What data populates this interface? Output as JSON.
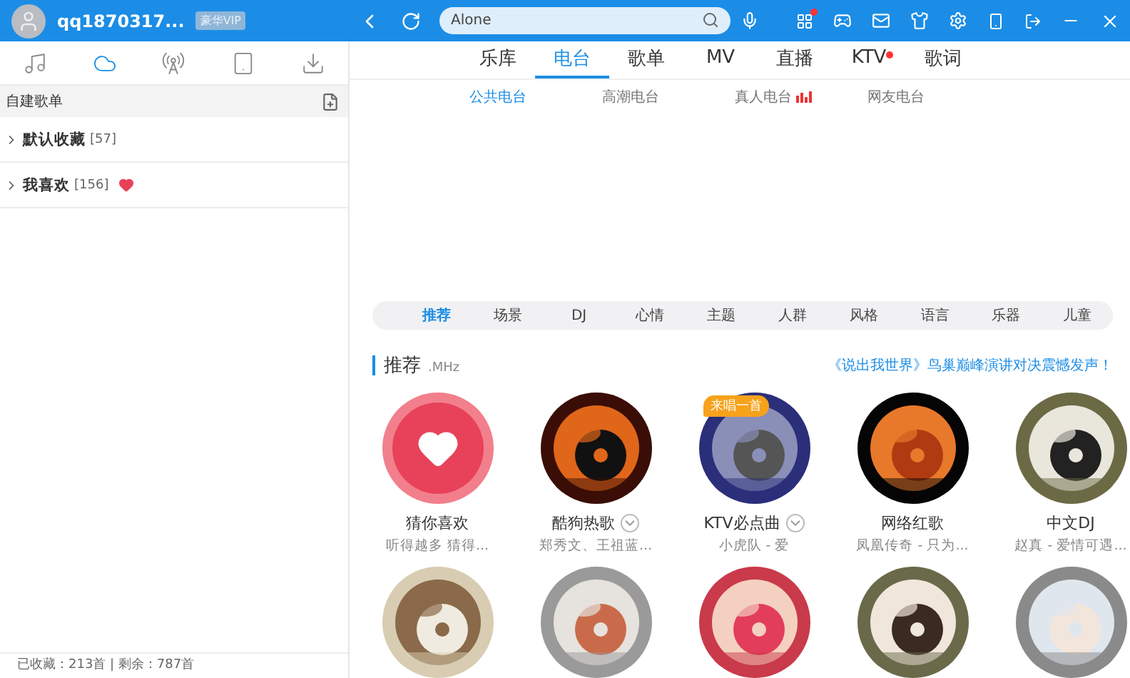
{
  "header": {
    "username": "qq1870317...",
    "vip_badge": "豪华VIP",
    "search": {
      "value": "Alone"
    },
    "apps_dot": true
  },
  "left_tabs": [
    {
      "kind": "music",
      "selected": false
    },
    {
      "kind": "cloud",
      "selected": true
    },
    {
      "kind": "radio",
      "selected": false
    },
    {
      "kind": "device",
      "selected": false
    },
    {
      "kind": "download",
      "selected": false
    }
  ],
  "playlist_section": {
    "title": "自建歌单"
  },
  "playlists": [
    {
      "name": "默认收藏",
      "count": "[57]",
      "liked": false
    },
    {
      "name": "我喜欢",
      "count": "[156]",
      "liked": true
    }
  ],
  "status_bar": "已收藏：213首 | 剩余：787首",
  "nav_tabs": [
    {
      "label": "乐库",
      "selected": false,
      "dot": false
    },
    {
      "label": "电台",
      "selected": true,
      "dot": false
    },
    {
      "label": "歌单",
      "selected": false,
      "dot": false
    },
    {
      "label": "MV",
      "selected": false,
      "dot": false
    },
    {
      "label": "直播",
      "selected": false,
      "dot": false
    },
    {
      "label": "KTV",
      "selected": false,
      "dot": true
    },
    {
      "label": "歌词",
      "selected": false,
      "dot": false
    }
  ],
  "sub_tabs": [
    {
      "label": "公共电台",
      "selected": true,
      "live": false
    },
    {
      "label": "高潮电台",
      "selected": false,
      "live": false
    },
    {
      "label": "真人电台",
      "selected": false,
      "live": true
    },
    {
      "label": "网友电台",
      "selected": false,
      "live": false
    }
  ],
  "categories": [
    {
      "label": "推荐",
      "selected": true
    },
    {
      "label": "场景",
      "selected": false
    },
    {
      "label": "DJ",
      "selected": false
    },
    {
      "label": "心情",
      "selected": false
    },
    {
      "label": "主题",
      "selected": false
    },
    {
      "label": "人群",
      "selected": false
    },
    {
      "label": "风格",
      "selected": false
    },
    {
      "label": "语言",
      "selected": false
    },
    {
      "label": "乐器",
      "selected": false
    },
    {
      "label": "儿童",
      "selected": false
    }
  ],
  "section": {
    "title": "推荐",
    "suffix": ".MHz",
    "promo": "《说出我世界》鸟巢巅峰演讲对决震憾发声！"
  },
  "stations": [
    {
      "kind": "heart",
      "title": "猜你喜欢",
      "subtitle": "听得越多 猜得..."
    },
    {
      "kind": "picture",
      "title": "酷狗热歌",
      "subtitle": "郑秀文、王祖蓝...",
      "menu": true
    },
    {
      "kind": "picture",
      "title": "KTV必点曲",
      "subtitle": "小虎队 - 爱",
      "menu": true,
      "badge": "来唱一首"
    },
    {
      "kind": "picture",
      "title": "网络红歌",
      "subtitle": "凤凰传奇 - 只为..."
    },
    {
      "kind": "picture",
      "title": "中文DJ",
      "subtitle": "赵真 - 爱情可遇..."
    },
    {
      "kind": "picture"
    },
    {
      "kind": "picture"
    },
    {
      "kind": "picture"
    },
    {
      "kind": "picture"
    },
    {
      "kind": "picture"
    }
  ]
}
